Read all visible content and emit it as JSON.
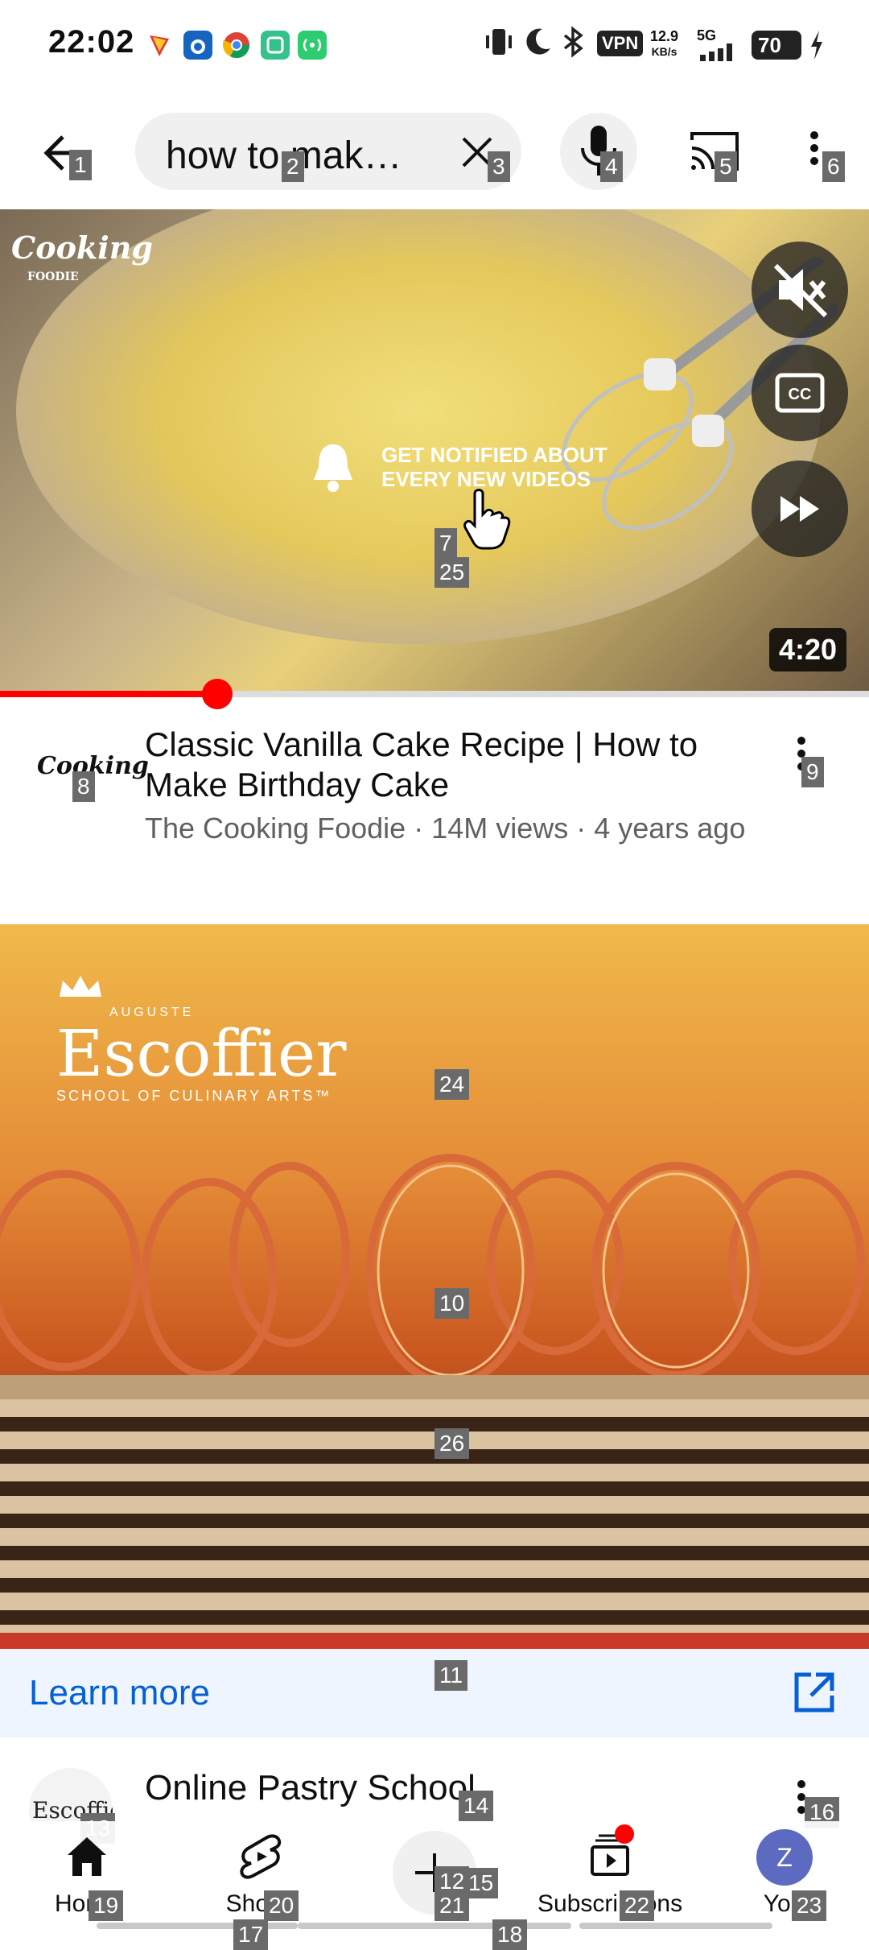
{
  "status_bar": {
    "time": "22:02",
    "vpn_label": "VPN",
    "speed_value": "12.9",
    "speed_unit": "KB/s",
    "network": "5G",
    "battery": "70"
  },
  "search_bar": {
    "query": "how to mak…",
    "tags": [
      "1",
      "2",
      "3",
      "4",
      "5",
      "6"
    ]
  },
  "video": {
    "brand_logo": "Cooking",
    "brand_logo_sub": "FOODIE",
    "notify_line1": "GET NOTIFIED ABOUT",
    "notify_line2": "EVERY NEW VIDEOS",
    "duration": "4:20",
    "progress_fraction": 0.25,
    "title": "Classic Vanilla Cake Recipe | How to Make Birthday Cake",
    "meta": "The Cooking Foodie · 14M views · 4 years ago",
    "channel_avatar_text": "Cooking",
    "tags": {
      "player": "7",
      "player_b": "25",
      "avatar": "8",
      "menu": "9"
    }
  },
  "ad": {
    "logo_top": "AUGUSTE",
    "logo_main": "Escoffier",
    "logo_bottom": "SCHOOL OF CULINARY ARTS™",
    "learn_more": "Learn more",
    "title": "Online Pastry School",
    "avatar_text": "Escoffier",
    "tags": {
      "a": "24",
      "b": "10",
      "c": "26",
      "learn": "11",
      "avatar": "13",
      "title": "14",
      "menu": "16",
      "t12": "12",
      "t15": "15",
      "t17": "17",
      "t18": "18"
    }
  },
  "bottom_nav": {
    "home": "Home",
    "shorts": "Shorts",
    "subscriptions": "Subscriptions",
    "you": "You",
    "you_initial": "Z",
    "tags": {
      "home": "19",
      "shorts": "20",
      "create": "21",
      "subs": "22",
      "you": "23"
    }
  },
  "colors": {
    "accent_red": "#ff0000",
    "link_blue": "#065fd4"
  }
}
